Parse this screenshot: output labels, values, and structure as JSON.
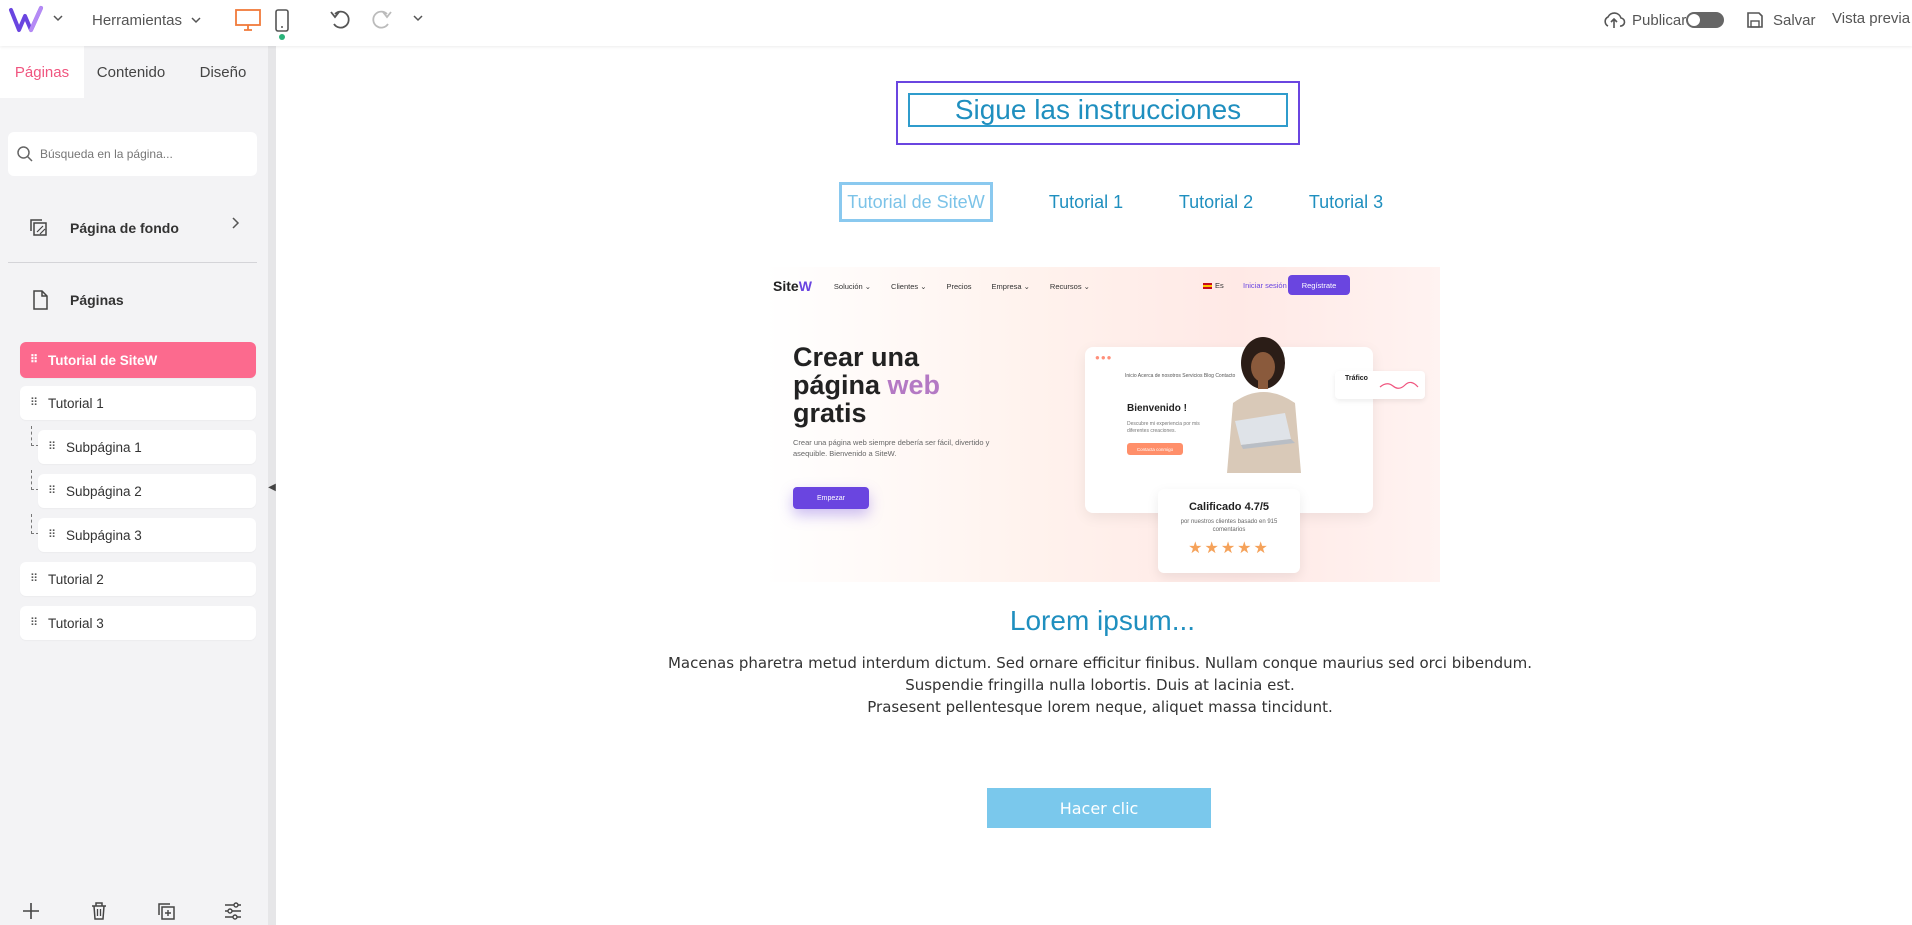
{
  "topbar": {
    "tools_label": "Herramientas",
    "publish_label": "Publicar",
    "save_label": "Salvar",
    "preview_label": "Vista previa"
  },
  "sidebar": {
    "tabs": [
      {
        "label": "Páginas",
        "active": true
      },
      {
        "label": "Contenido",
        "active": false
      },
      {
        "label": "Diseño",
        "active": false
      }
    ],
    "search_placeholder": "Búsqueda en la página...",
    "background_page_label": "Página de fondo",
    "pages_label": "Páginas",
    "pages": [
      {
        "label": "Tutorial de SiteW",
        "level": 0,
        "active": true
      },
      {
        "label": "Tutorial 1",
        "level": 0,
        "active": false
      },
      {
        "label": "Subpágina 1",
        "level": 1,
        "active": false
      },
      {
        "label": "Subpágina 2",
        "level": 1,
        "active": false
      },
      {
        "label": "Subpágina 3",
        "level": 1,
        "active": false
      },
      {
        "label": "Tutorial 2",
        "level": 0,
        "active": false
      },
      {
        "label": "Tutorial 3",
        "level": 0,
        "active": false
      }
    ]
  },
  "canvas": {
    "title": "Sigue las instrucciones",
    "nav": [
      {
        "label": "Tutorial de SiteW",
        "selected": true
      },
      {
        "label": "Tutorial 1",
        "selected": false
      },
      {
        "label": "Tutorial 2",
        "selected": false
      },
      {
        "label": "Tutorial 3",
        "selected": false
      }
    ],
    "hero": {
      "brand_a": "Site",
      "brand_b": "W",
      "nav_links": [
        "Solución ⌄",
        "Clientes ⌄",
        "Precios",
        "Empresa ⌄",
        "Recursos ⌄"
      ],
      "lang": "Es",
      "login": "Iniciar sesión",
      "register": "Regístrate",
      "headline_a": "Crear una página ",
      "headline_b": "web",
      "headline_c": " gratis",
      "subtext": "Crear una página web siempre debería ser fácil, divertido y asequible. Bienvenido a SiteW.",
      "cta": "Empezar",
      "mock_nav": "Inicio   Acerca de nosotros   Servicios   Blog   Contacto",
      "mock_welcome": "Bienvenido !",
      "mock_text": "Descubre mi experiencia por mis diferentes creaciones.",
      "mock_button": "Contacta conmigo",
      "traffic": "Tráfico",
      "rating_title": "Calificado 4.7/5",
      "rating_sub": "por nuestros clientes basado en 915 comentarios",
      "stars": "★★★★★"
    },
    "heading": "Lorem ipsum...",
    "paragraph": [
      "Macenas pharetra metud interdum dictum. Sed ornare efficitur finibus. Nullam conque maurius sed orci bibendum.",
      "Suspendie fringilla nulla lobortis. Duis at lacinia est.",
      "Prasesent pellentesque lorem neque, aliquet massa tincidunt."
    ],
    "button": "Hacer clic"
  },
  "colors": {
    "accent_pink": "#f0557f",
    "active_page_bg": "#fc6a8e",
    "title_blue": "#1f8fbf",
    "brand_purple": "#6a45e0",
    "button_blue": "#7ac8ec"
  }
}
